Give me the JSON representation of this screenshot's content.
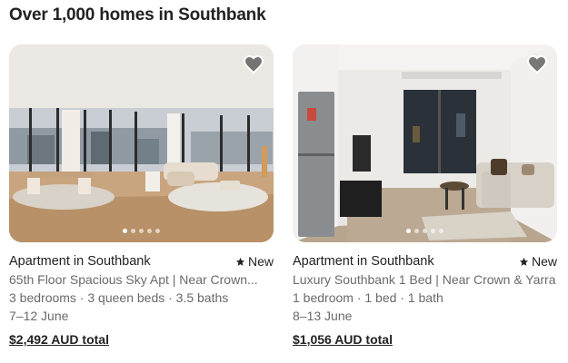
{
  "heading": "Over 1,000 homes in Southbank",
  "listings": [
    {
      "type": "Apartment in Southbank",
      "badge": "New",
      "name": "65th Floor Spacious Sky Apt | Near Crown...",
      "details": "3 bedrooms · 3 queen beds · 3.5 baths",
      "dates": "7–12 June",
      "price": "$2,492 AUD total",
      "photo_count": 5,
      "active_photo": 1
    },
    {
      "type": "Apartment in Southbank",
      "badge": "New",
      "name": "Luxury Southbank 1 Bed | Near Crown & Yarra",
      "details": "1 bedroom · 1 bed · 1 bath",
      "dates": "8–13 June",
      "price": "$1,056 AUD total",
      "photo_count": 5,
      "active_photo": 1
    }
  ],
  "icons": {
    "favorite": "heart-icon",
    "badge": "star-icon"
  },
  "colors": {
    "text": "#222222",
    "muted": "#6a6a6a"
  }
}
